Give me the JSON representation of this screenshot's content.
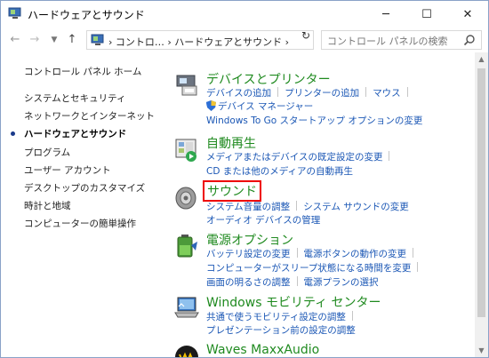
{
  "window": {
    "title": "ハードウェアとサウンド",
    "minimize_label": "─",
    "maximize_label": "☐",
    "close_label": "✕"
  },
  "address": {
    "crumbs": "› コントロ… › ハードウェアとサウンド ›",
    "search_placeholder": "コントロール パネルの検索"
  },
  "sidebar": {
    "items": [
      {
        "label": "コントロール パネル ホーム"
      },
      {
        "label": "システムとセキュリティ"
      },
      {
        "label": "ネットワークとインターネット"
      },
      {
        "label": "ハードウェアとサウンド"
      },
      {
        "label": "プログラム"
      },
      {
        "label": "ユーザー アカウント"
      },
      {
        "label": "デスクトップのカスタマイズ"
      },
      {
        "label": "時計と地域"
      },
      {
        "label": "コンピューターの簡単操作"
      }
    ]
  },
  "categories": {
    "devices": {
      "title": "デバイスとプリンター",
      "links": [
        "デバイスの追加",
        "プリンターの追加",
        "マウス",
        "デバイス マネージャー",
        "Windows To Go スタートアップ オプションの変更"
      ]
    },
    "autoplay": {
      "title": "自動再生",
      "links": [
        "メディアまたはデバイスの既定設定の変更",
        "CD または他のメディアの自動再生"
      ]
    },
    "sound": {
      "title": "サウンド",
      "links": [
        "システム音量の調整",
        "システム サウンドの変更",
        "オーディオ デバイスの管理"
      ]
    },
    "power": {
      "title": "電源オプション",
      "links": [
        "バッテリ設定の変更",
        "電源ボタンの動作の変更",
        "コンピューターがスリープ状態になる時間を変更",
        "画面の明るさの調整",
        "電源プランの選択"
      ]
    },
    "mobility": {
      "title": "Windows モビリティ センター",
      "links": [
        "共通で使うモビリティ設定の調整",
        "プレゼンテーション前の設定の調整"
      ]
    },
    "waves": {
      "title": "Waves MaxxAudio"
    }
  }
}
